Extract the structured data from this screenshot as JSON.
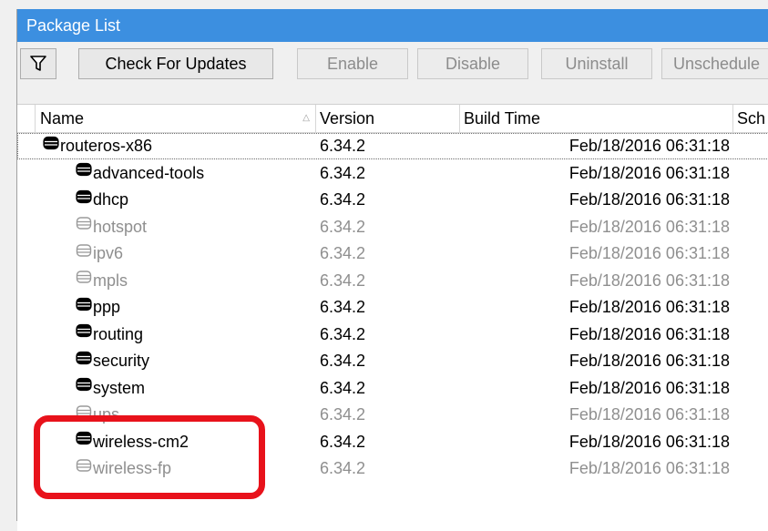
{
  "window": {
    "title": "Package List"
  },
  "toolbar": {
    "filter_icon": "filter-funnel-icon",
    "check_for_updates": "Check For Updates",
    "enable": "Enable",
    "disable": "Disable",
    "uninstall": "Uninstall",
    "unschedule": "Unschedule"
  },
  "columns": {
    "name": "Name",
    "version": "Version",
    "build_time": "Build Time",
    "scheduled": "Sch"
  },
  "rows": [
    {
      "name": "routeros-x86",
      "version": "6.34.2",
      "build_time": "Feb/18/2016 06:31:18",
      "enabled": true,
      "level": 0
    },
    {
      "name": "advanced-tools",
      "version": "6.34.2",
      "build_time": "Feb/18/2016 06:31:18",
      "enabled": true,
      "level": 1
    },
    {
      "name": "dhcp",
      "version": "6.34.2",
      "build_time": "Feb/18/2016 06:31:18",
      "enabled": true,
      "level": 1
    },
    {
      "name": "hotspot",
      "version": "6.34.2",
      "build_time": "Feb/18/2016 06:31:18",
      "enabled": false,
      "level": 1
    },
    {
      "name": "ipv6",
      "version": "6.34.2",
      "build_time": "Feb/18/2016 06:31:18",
      "enabled": false,
      "level": 1
    },
    {
      "name": "mpls",
      "version": "6.34.2",
      "build_time": "Feb/18/2016 06:31:18",
      "enabled": false,
      "level": 1
    },
    {
      "name": "ppp",
      "version": "6.34.2",
      "build_time": "Feb/18/2016 06:31:18",
      "enabled": true,
      "level": 1
    },
    {
      "name": "routing",
      "version": "6.34.2",
      "build_time": "Feb/18/2016 06:31:18",
      "enabled": true,
      "level": 1
    },
    {
      "name": "security",
      "version": "6.34.2",
      "build_time": "Feb/18/2016 06:31:18",
      "enabled": true,
      "level": 1
    },
    {
      "name": "system",
      "version": "6.34.2",
      "build_time": "Feb/18/2016 06:31:18",
      "enabled": true,
      "level": 1
    },
    {
      "name": "ups",
      "version": "6.34.2",
      "build_time": "Feb/18/2016 06:31:18",
      "enabled": false,
      "level": 1
    },
    {
      "name": "wireless-cm2",
      "version": "6.34.2",
      "build_time": "Feb/18/2016 06:31:18",
      "enabled": true,
      "level": 1
    },
    {
      "name": "wireless-fp",
      "version": "6.34.2",
      "build_time": "Feb/18/2016 06:31:18",
      "enabled": false,
      "level": 1
    }
  ],
  "colors": {
    "titlebar": "#3c8fe0",
    "highlight": "#e8121b",
    "disabled_text": "#8f8f8f"
  }
}
